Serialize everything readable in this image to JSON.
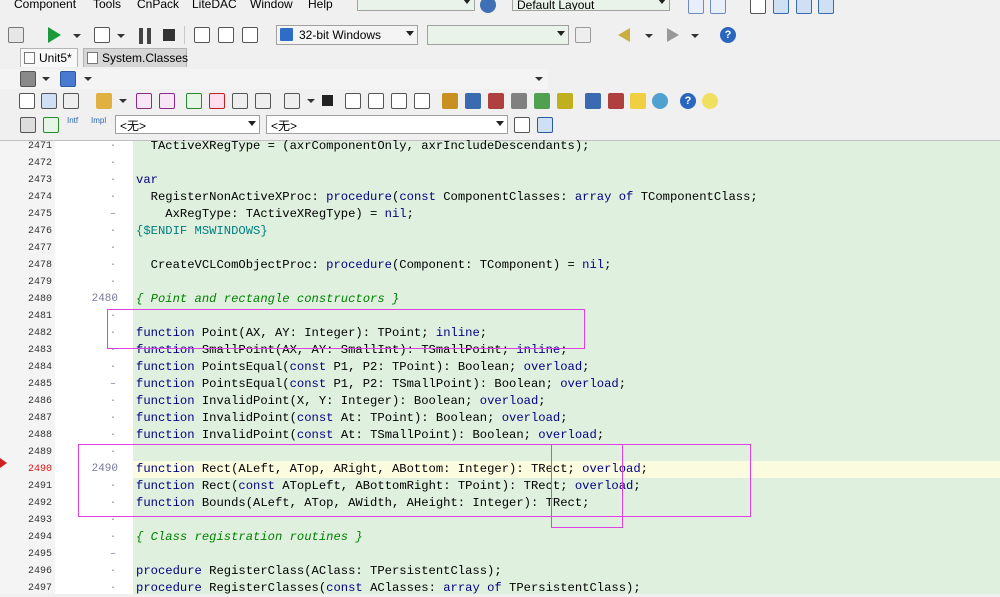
{
  "menu": [
    "Component",
    "Tools",
    "CnPack",
    "LiteDAC",
    "Window",
    "Help"
  ],
  "layout_combo": "Default Layout",
  "platform_combo": "32-bit Windows",
  "tabs": [
    {
      "label": "Unit5*"
    },
    {
      "label": "System.Classes"
    }
  ],
  "filter_combo_1": "<无>",
  "filter_combo_2": "<无>",
  "colors": {
    "accent_box": "#e040e0",
    "code_bg": "#dff0df",
    "current_line": "#fbfbe0",
    "keyword": "#000080",
    "comment": "#008000"
  },
  "gutter": {
    "numbers": [
      "2471",
      "2472",
      "2473",
      "2474",
      "2475",
      "2476",
      "2477",
      "2478",
      "2479",
      "2480",
      "2481",
      "2482",
      "2483",
      "2484",
      "2485",
      "2486",
      "2487",
      "2488",
      "2489",
      "2490",
      "2491",
      "2492",
      "2493",
      "2494",
      "2495",
      "2496",
      "2497"
    ],
    "marker_2480": "2480",
    "marker_2490": "2490"
  },
  "code": [
    {
      "t": "  TActiveXRegType = (axrComponentOnly, axrIncludeDescendants);"
    },
    {
      "t": ""
    },
    {
      "k": "var",
      "t": ""
    },
    {
      "t": "  RegisterNonActiveXProc: ",
      "k2": "procedure",
      "t2": "(",
      "k3": "const",
      "t3": " ComponentClasses: ",
      "k4": "array of",
      "t4": " TComponentClass;"
    },
    {
      "t": "    AxRegType: TActiveXRegType) = ",
      "k2": "nil",
      "t2": ";"
    },
    {
      "d": "{$ENDIF MSWINDOWS}"
    },
    {
      "t": ""
    },
    {
      "t": "  CreateVCLComObjectProc: ",
      "k2": "procedure",
      "t2": "(Component: TComponent) = ",
      "k3": "nil",
      "t3": ";"
    },
    {
      "t": ""
    },
    {
      "c": "{ Point and rectangle constructors }"
    },
    {
      "t": ""
    },
    {
      "k": "function",
      "t": " Point(AX, AY: Integer): TPoint; ",
      "k2": "inline",
      "t2": ";"
    },
    {
      "k": "function",
      "t": " SmallPoint(AX, AY: SmallInt): TSmallPoint; ",
      "k2": "inline",
      "t2": ";"
    },
    {
      "k": "function",
      "t": " PointsEqual(",
      "k2": "const",
      "t2": " P1, P2: TPoint): Boolean; ",
      "k3": "overload",
      "t3": ";"
    },
    {
      "k": "function",
      "t": " PointsEqual(",
      "k2": "const",
      "t2": " P1, P2: TSmallPoint): Boolean; ",
      "k3": "overload",
      "t3": ";"
    },
    {
      "k": "function",
      "t": " InvalidPoint(X, Y: Integer): Boolean; ",
      "k2": "overload",
      "t2": ";"
    },
    {
      "k": "function",
      "t": " InvalidPoint(",
      "k2": "const",
      "t2": " At: TPoint): Boolean; ",
      "k3": "overload",
      "t3": ";"
    },
    {
      "k": "function",
      "t": " InvalidPoint(",
      "k2": "const",
      "t2": " At: TSmallPoint): Boolean; ",
      "k3": "overload",
      "t3": ";"
    },
    {
      "t": ""
    },
    {
      "k": "function",
      "t": " Rect(ALeft, ATop, ARight, ABottom: Integer): TRect; ",
      "k2": "overload",
      "t2": ";"
    },
    {
      "k": "function",
      "t": " Rect(",
      "k2": "const",
      "t2": " ATopLeft, ABottomRight: TPoint): TRect; ",
      "k3": "overload",
      "t3": ";"
    },
    {
      "k": "function",
      "t": " Bounds(ALeft, ATop, AWidth, AHeight: Integer): TRect;"
    },
    {
      "t": ""
    },
    {
      "c": "{ Class registration routines }"
    },
    {
      "t": ""
    },
    {
      "k": "procedure",
      "t": " RegisterClass(AClass: TPersistentClass);"
    },
    {
      "k": "procedure",
      "t": " RegisterClasses(",
      "k2": "const",
      "t2": " AClasses: ",
      "k3": "array of",
      "t3": " TPersistentClass);"
    }
  ]
}
